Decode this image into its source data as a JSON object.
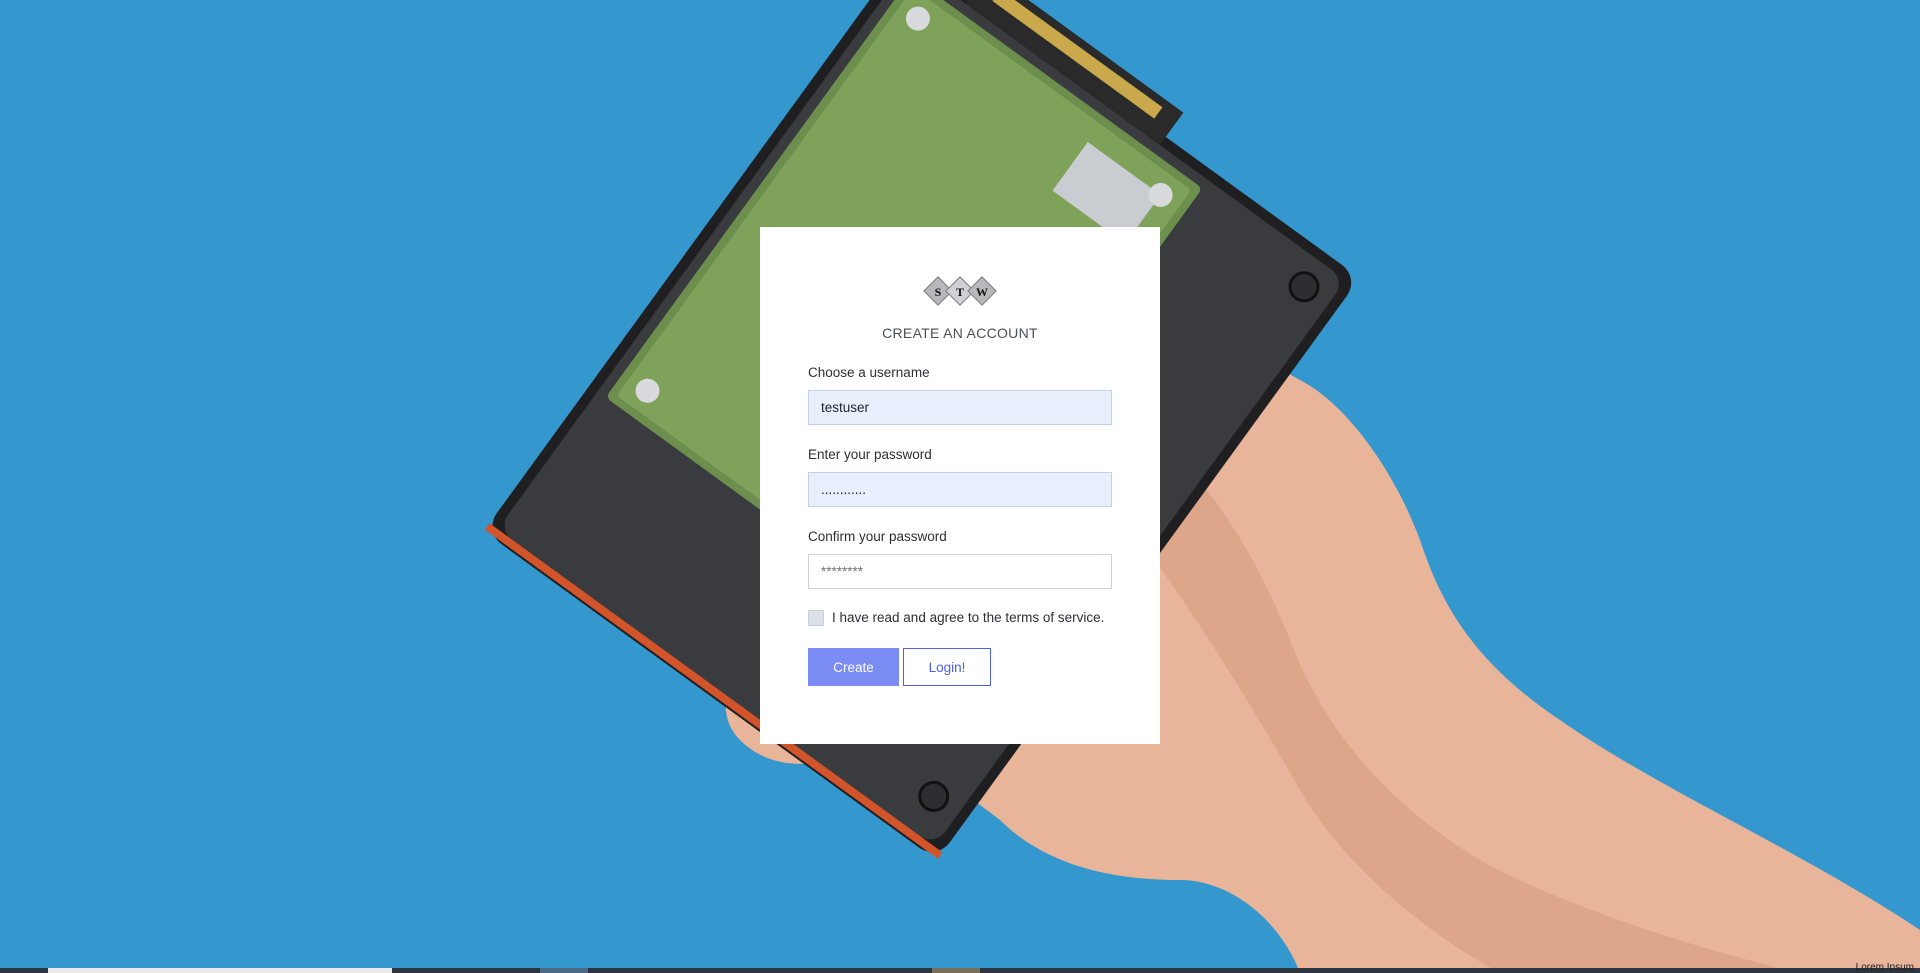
{
  "logo": {
    "letters": [
      "S",
      "T",
      "W"
    ]
  },
  "form": {
    "title": "CREATE AN ACCOUNT",
    "username": {
      "label": "Choose a username",
      "value": "testuser"
    },
    "password": {
      "label": "Enter your password",
      "value": "............"
    },
    "confirm": {
      "label": "Confirm your password",
      "placeholder": "********"
    },
    "terms": {
      "label": "I have read and agree to the terms of service.",
      "checked": false
    },
    "create_label": "Create",
    "login_label": "Login!"
  },
  "footer": {
    "corner_text": "Lorem Ipsum"
  },
  "colors": {
    "background": "#3497cd",
    "primary_button": "#7b8cf5",
    "outline_button": "#4e5fe0",
    "autofill": "#e8f0fe"
  }
}
